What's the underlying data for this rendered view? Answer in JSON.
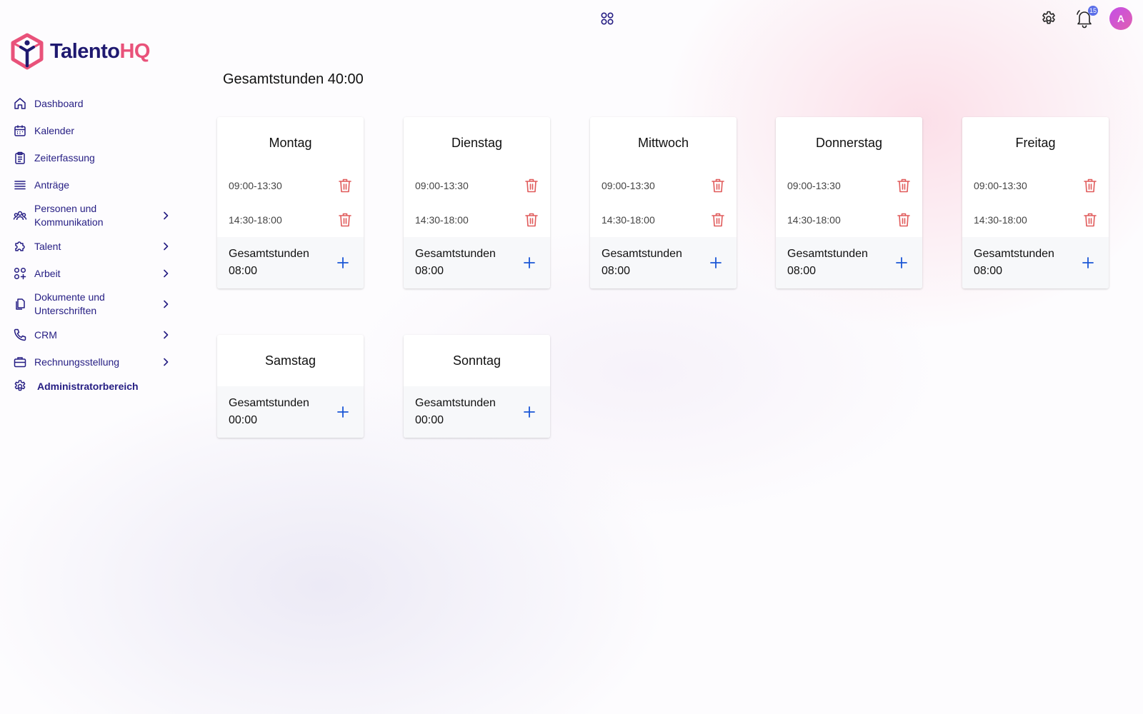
{
  "brand": {
    "name_part1": "Talento",
    "name_part2": "HQ"
  },
  "topbar": {
    "icons": [
      "apps-grid-icon",
      "gear-icon",
      "bell-icon"
    ],
    "notification_count": "15",
    "avatar_initial": "A"
  },
  "sidebar": {
    "items": [
      {
        "label": "Dashboard",
        "icon": "home-icon",
        "has_chevron": false
      },
      {
        "label": "Kalender",
        "icon": "calendar-icon",
        "has_chevron": false
      },
      {
        "label": "Zeiterfassung",
        "icon": "clipboard-icon",
        "has_chevron": false
      },
      {
        "label": "Anträge",
        "icon": "list-icon",
        "has_chevron": false
      },
      {
        "label": "Personen und Kommunikation",
        "icon": "people-icon",
        "has_chevron": true
      },
      {
        "label": "Talent",
        "icon": "puzzle-icon",
        "has_chevron": true
      },
      {
        "label": "Arbeit",
        "icon": "grid-plus-icon",
        "has_chevron": true
      },
      {
        "label": "Dokumente und Unterschriften",
        "icon": "documents-icon",
        "has_chevron": true
      },
      {
        "label": "CRM",
        "icon": "phone-icon",
        "has_chevron": true
      },
      {
        "label": "Rechnungsstellung",
        "icon": "briefcase-icon",
        "has_chevron": true
      },
      {
        "label": "Administratorbereich",
        "icon": "gear-icon",
        "has_chevron": false
      }
    ]
  },
  "main": {
    "total_label": "Gesamtstunden 40:00",
    "days": [
      {
        "name": "Montag",
        "slots": [
          "09:00-13:30",
          "14:30-18:00"
        ],
        "total_label": "Gesamtstunden",
        "total_value": "08:00"
      },
      {
        "name": "Dienstag",
        "slots": [
          "09:00-13:30",
          "14:30-18:00"
        ],
        "total_label": "Gesamtstunden",
        "total_value": "08:00"
      },
      {
        "name": "Mittwoch",
        "slots": [
          "09:00-13:30",
          "14:30-18:00"
        ],
        "total_label": "Gesamtstunden",
        "total_value": "08:00"
      },
      {
        "name": "Donnerstag",
        "slots": [
          "09:00-13:30",
          "14:30-18:00"
        ],
        "total_label": "Gesamtstunden",
        "total_value": "08:00"
      },
      {
        "name": "Freitag",
        "slots": [
          "09:00-13:30",
          "14:30-18:00"
        ],
        "total_label": "Gesamtstunden",
        "total_value": "08:00"
      },
      {
        "name": "Samstag",
        "slots": [],
        "total_label": "Gesamtstunden",
        "total_value": "00:00"
      },
      {
        "name": "Sonntag",
        "slots": [],
        "total_label": "Gesamtstunden",
        "total_value": "00:00"
      }
    ]
  },
  "colors": {
    "brand_dark": "#1f1970",
    "brand_accent": "#e9527a",
    "nav_text": "#251d83",
    "trash_red": "#e05a5a",
    "plus_blue": "#1a56d6"
  }
}
